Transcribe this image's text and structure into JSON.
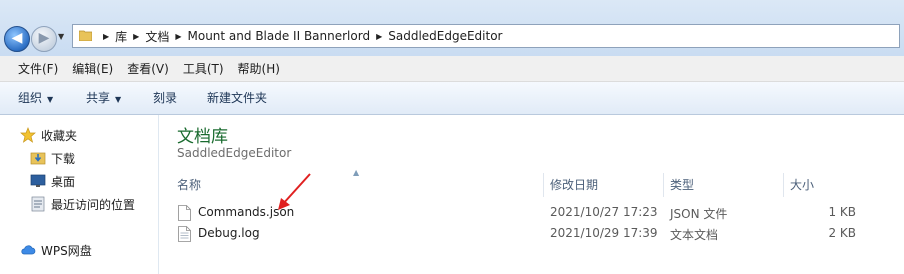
{
  "address": {
    "crumbs": [
      "库",
      "文档",
      "Mount and Blade II Bannerlord",
      "SaddledEdgeEditor"
    ]
  },
  "menu": [
    "文件(F)",
    "编辑(E)",
    "查看(V)",
    "工具(T)",
    "帮助(H)"
  ],
  "toolbar": {
    "organize": "组织",
    "share": "共享",
    "burn": "刻录",
    "new_folder": "新建文件夹"
  },
  "sidebar": {
    "favorites": "收藏夹",
    "downloads": "下载",
    "desktop": "桌面",
    "recent": "最近访问的位置",
    "wps": "WPS网盘"
  },
  "library": {
    "title": "文档库",
    "subtitle": "SaddledEdgeEditor"
  },
  "columns": {
    "name": "名称",
    "date": "修改日期",
    "type": "类型",
    "size": "大小"
  },
  "files": [
    {
      "name": "Commands.json",
      "date": "2021/10/27 17:23",
      "type": "JSON 文件",
      "size": "1 KB"
    },
    {
      "name": "Debug.log",
      "date": "2021/10/29 17:39",
      "type": "文本文档",
      "size": "2 KB"
    }
  ],
  "colors": {
    "annotation_arrow": "#e02020",
    "library_title": "#1a6b2f"
  }
}
